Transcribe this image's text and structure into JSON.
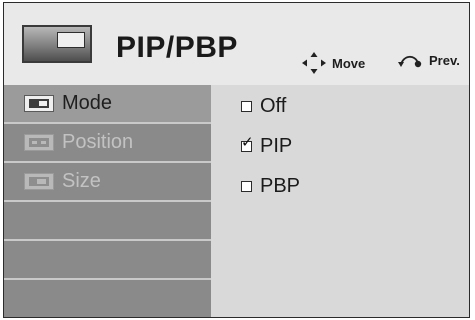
{
  "header": {
    "title": "PIP/PBP",
    "icon": "pip-tv-icon",
    "hints": [
      {
        "label": "Move",
        "icon": "move-arrows-icon"
      },
      {
        "label": "Prev.",
        "icon": "back-arrow-icon"
      }
    ]
  },
  "menu": {
    "items": [
      {
        "label": "Mode",
        "icon": "mode-icon",
        "state": "selected"
      },
      {
        "label": "Position",
        "icon": "position-icon",
        "state": "disabled"
      },
      {
        "label": "Size",
        "icon": "size-icon",
        "state": "disabled"
      }
    ],
    "empty_rows": 3
  },
  "options": {
    "items": [
      {
        "label": "Off",
        "checked": false
      },
      {
        "label": "PIP",
        "checked": true
      },
      {
        "label": "PBP",
        "checked": false
      }
    ]
  },
  "colors": {
    "header_bg": "#e9e9e9",
    "menu_bg": "#8a8a8a",
    "options_bg": "#d9d9d9",
    "dim_text": "#c2c2c2"
  }
}
